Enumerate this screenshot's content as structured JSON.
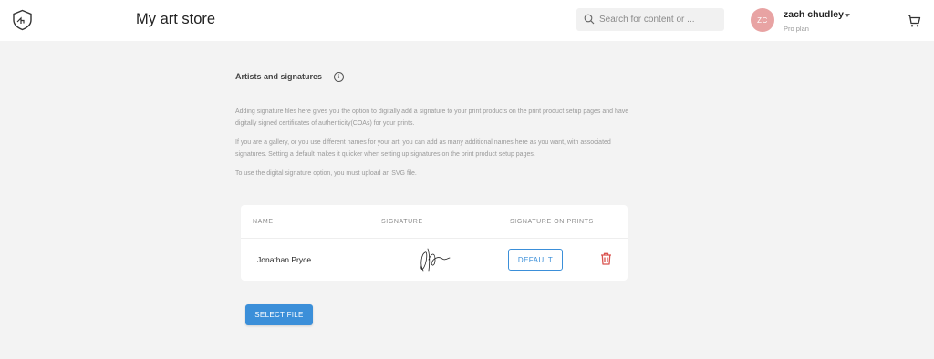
{
  "header": {
    "store_title": "My art store",
    "logo_icon": "shield-h-logo-icon",
    "search": {
      "placeholder": "Search for content or ...",
      "icon": "search-icon"
    },
    "user": {
      "initials": "ZC",
      "name": "zach chudley",
      "plan": "Pro plan",
      "avatar_color": "#e8a3a3"
    },
    "cart_icon": "shopping-cart-icon"
  },
  "section": {
    "title": "Artists and signatures",
    "info_icon": "info-icon",
    "info_glyph": "i",
    "paragraphs": [
      "Adding signature files here gives you the option to digitally add a signature to your print products on the print product setup pages and have digitally signed certificates of authenticity(COAs) for your prints.",
      "If you are a gallery, or you use different names for your art, you can add as many additional names here as you want, with associated signatures. Setting a default makes it quicker when setting up signatures on the print product setup pages.",
      "To use the digital signature option, you must upload an SVG file."
    ]
  },
  "table": {
    "columns": [
      "NAME",
      "SIGNATURE",
      "SIGNATURE ON PRINTS"
    ],
    "rows": [
      {
        "name": "Jonathan Pryce",
        "signature_icon": "signature-image",
        "default_label": "DEFAULT",
        "delete_icon": "trash-icon"
      }
    ]
  },
  "actions": {
    "select_file_label": "SELECT FILE"
  },
  "colors": {
    "accent": "#3b8fd9",
    "danger": "#d9534f",
    "background": "#f3f3f3"
  }
}
